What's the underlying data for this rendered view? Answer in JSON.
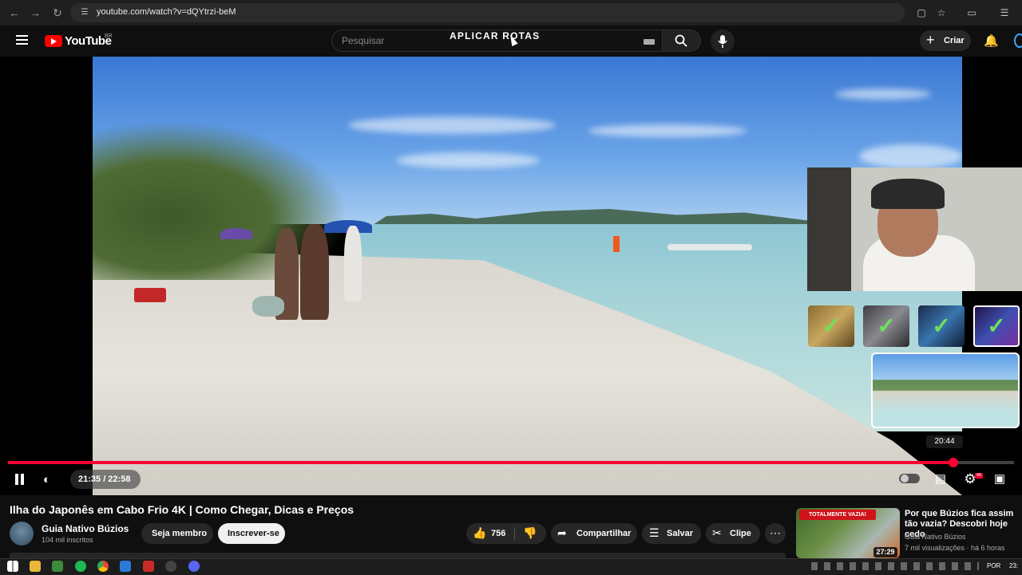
{
  "browser": {
    "url": "youtube.com/watch?v=dQYtrzi-beM"
  },
  "header": {
    "logo_text": "YouTube",
    "country_code": "BR",
    "search_placeholder": "Pesquisar",
    "create_label": "Criar"
  },
  "overlay": {
    "title": "APLICAR ROTAS"
  },
  "player": {
    "current_time": "21:35",
    "duration": "22:58",
    "time_display": "21:35 / 22:58",
    "progress_fraction": 0.94,
    "hover_preview_time": "20:44",
    "hd_badge": "4K",
    "state": "playing"
  },
  "video": {
    "title": "Ilha do Japonês em Cabo Frio 4K | Como Chegar, Dicas e Preços",
    "channel_name": "Guia Nativo Búzios",
    "subscribers": "104 mil inscritos",
    "member_label": "Seja membro",
    "subscribe_label": "Inscrever-se",
    "likes": "756",
    "share_label": "Compartilhar",
    "save_label": "Salvar",
    "clip_label": "Clipe"
  },
  "recommendation": {
    "title": "Por que Búzios fica assim tão vazia? Descobri hoje cedo",
    "channel": "Guia Nativo Búzios",
    "meta": "7 mil visualizações · há 6 horas",
    "duration": "27:29",
    "badge": "TOTALMENTE VAZIA!"
  },
  "taskbar": {
    "language": "POR",
    "clock": "23:"
  },
  "colors": {
    "accent": "#ff0033",
    "logo_red": "#ff0000",
    "check_green": "#6fe05a",
    "background": "#0f0f0f"
  }
}
